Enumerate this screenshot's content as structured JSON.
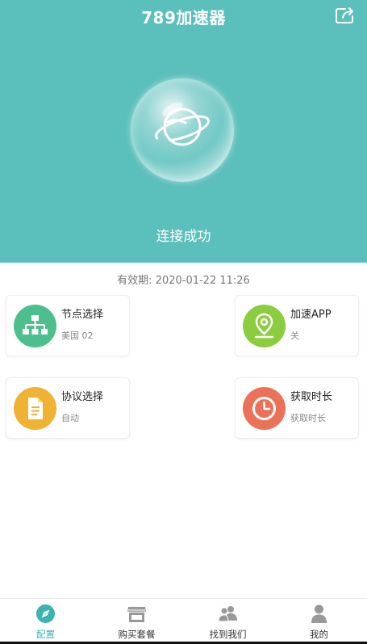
{
  "header": {
    "title": "789加速器",
    "status": "连接成功",
    "bg_color": "#5bbfbb"
  },
  "validity": "有效期: 2020-01-22 11:26",
  "cards": [
    {
      "title": "节点选择",
      "subtitle": "美国 02",
      "icon": "network-tree-icon",
      "color": "#4dbf8e"
    },
    {
      "title": "加速APP",
      "subtitle": "关",
      "icon": "location-pin-icon",
      "color": "#8ccc3f"
    },
    {
      "title": "协议选择",
      "subtitle": "自动",
      "icon": "document-icon",
      "color": "#efb233"
    },
    {
      "title": "获取时长",
      "subtitle": "获取时长",
      "icon": "clock-icon",
      "color": "#eb7259"
    }
  ],
  "tabs": [
    {
      "label": "配置",
      "icon": "compass-icon",
      "active": true
    },
    {
      "label": "购买套餐",
      "icon": "store-icon",
      "active": false
    },
    {
      "label": "找到我们",
      "icon": "users-icon",
      "active": false
    },
    {
      "label": "我的",
      "icon": "person-icon",
      "active": false
    }
  ],
  "accent_color": "#3bb3b0"
}
